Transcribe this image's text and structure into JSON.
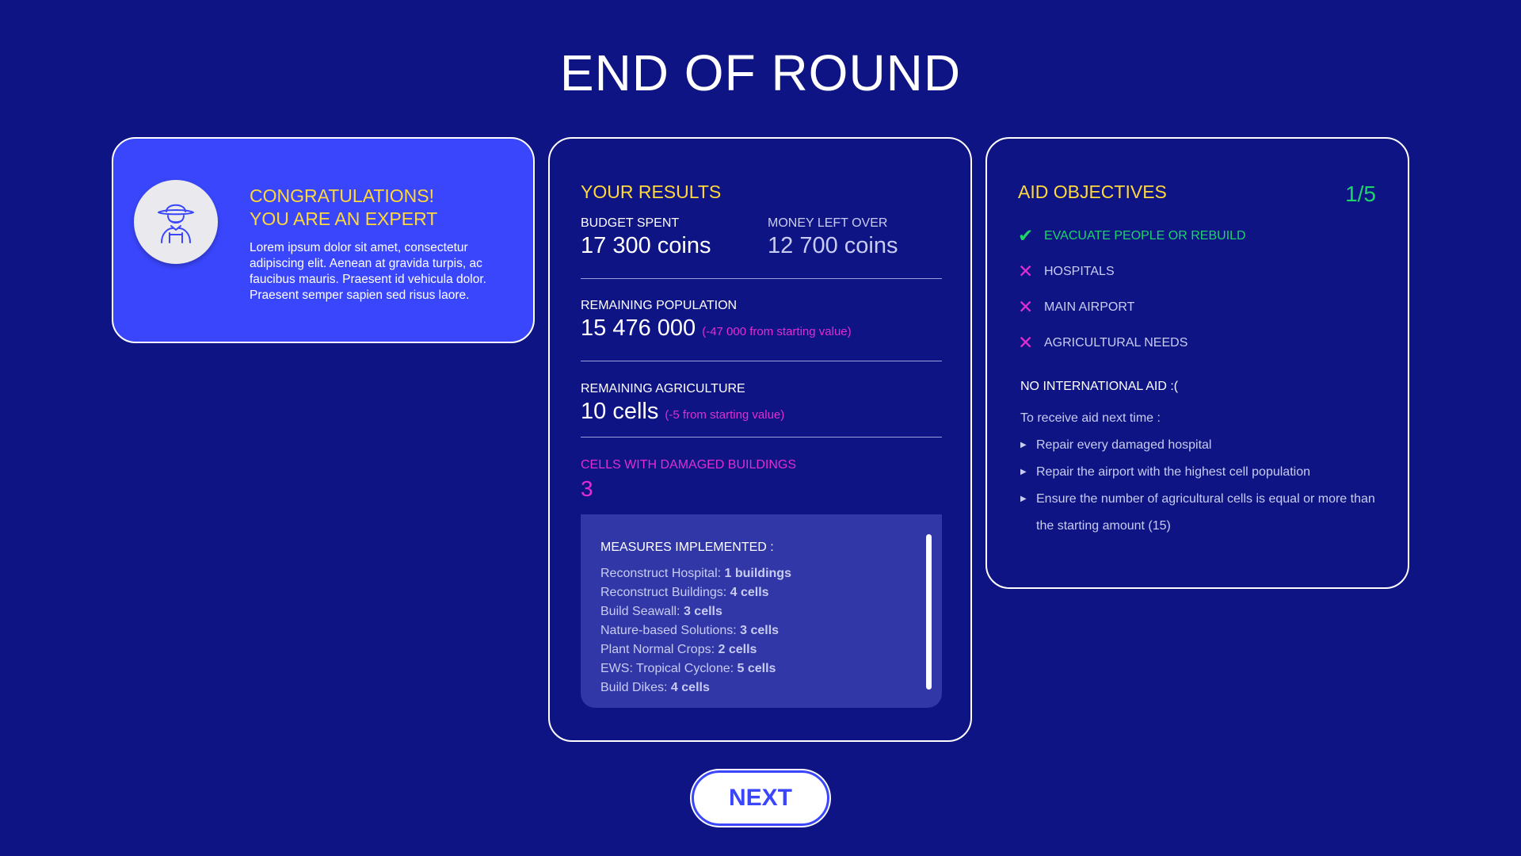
{
  "title": "END OF ROUND",
  "expert_card": {
    "heading_line1": "CONGRATULATIONS!",
    "heading_line2": "YOU ARE AN EXPERT",
    "body": "Lorem ipsum dolor sit amet, consectetur adipiscing elit. Aenean at gravida turpis, ac faucibus mauris. Praesent id vehicula dolor. Praesent semper sapien sed risus laore.",
    "avatar_icon": "farmer-icon"
  },
  "results": {
    "title": "YOUR RESULTS",
    "budget_spent_label": "BUDGET SPENT",
    "budget_spent_value": "17 300 coins",
    "money_left_label": "MONEY LEFT OVER",
    "money_left_value": "12 700 coins",
    "population_label": "REMAINING POPULATION",
    "population_value": "15 476 000",
    "population_delta": "(-47 000 from starting value)",
    "agriculture_label": "REMAINING AGRICULTURE",
    "agriculture_value": "10 cells",
    "agriculture_delta": "(-5 from starting value)",
    "damaged_label": "CELLS WITH DAMAGED BUILDINGS",
    "damaged_value": "3",
    "measures_title": "MEASURES IMPLEMENTED :",
    "measures": [
      {
        "name": "Reconstruct Hospital: ",
        "amount": "1 buildings"
      },
      {
        "name": "Reconstruct Buildings: ",
        "amount": "4 cells"
      },
      {
        "name": "Build Seawall: ",
        "amount": "3 cells"
      },
      {
        "name": "Nature-based Solutions: ",
        "amount": "3 cells"
      },
      {
        "name": "Plant Normal Crops: ",
        "amount": "2 cells"
      },
      {
        "name": "EWS: Tropical Cyclone: ",
        "amount": "5 cells"
      },
      {
        "name": "Build Dikes: ",
        "amount": "4 cells"
      }
    ]
  },
  "aid": {
    "title": "AID OBJECTIVES",
    "count": "1/5",
    "objectives": [
      {
        "label": "EVACUATE PEOPLE OR REBUILD",
        "status": "check-icon"
      },
      {
        "label": "HOSPITALS",
        "status": "cross-icon"
      },
      {
        "label": "MAIN AIRPORT",
        "status": "cross-icon"
      },
      {
        "label": "AGRICULTURAL NEEDS",
        "status": "cross-icon"
      }
    ],
    "no_aid": "NO INTERNATIONAL AID :(",
    "hint": "To receive aid next time :",
    "requirements": [
      "Repair every damaged hospital",
      "Repair the airport with the highest cell population",
      "Ensure the number of agricultural cells is equal or more than the starting amount (15)"
    ]
  },
  "next_label": "NEXT",
  "colors": {
    "background": "#0e1484",
    "accent_blue": "#3a46fb",
    "yellow": "#ffd83a",
    "green": "#1fd36b",
    "magenta": "#e22dd2"
  }
}
